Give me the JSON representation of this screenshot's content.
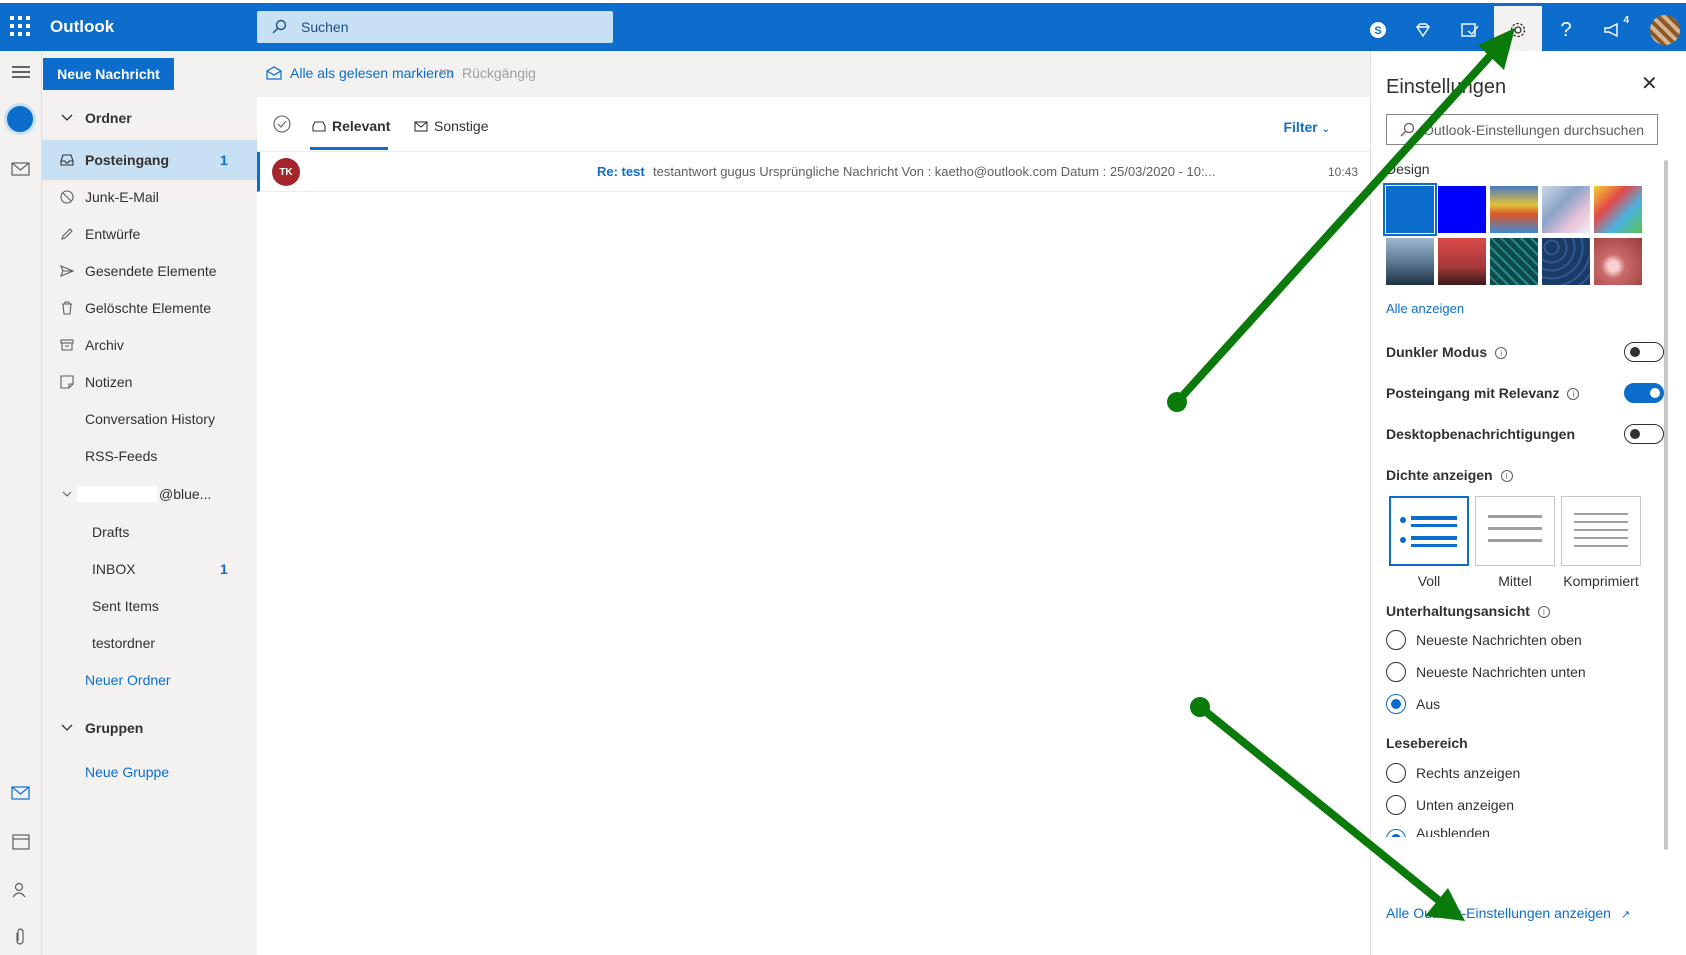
{
  "header": {
    "app_title": "Outlook",
    "search_placeholder": "Suchen",
    "notification_count": "4"
  },
  "commandbar": {
    "new_message": "Neue Nachricht",
    "mark_all_read": "Alle als gelesen markieren",
    "undo": "Rückgängig"
  },
  "folders": {
    "section_title": "Ordner",
    "inbox": "Posteingang",
    "inbox_count": "1",
    "junk": "Junk-E-Mail",
    "drafts": "Entwürfe",
    "sent": "Gesendete Elemente",
    "deleted": "Gelöschte Elemente",
    "archive": "Archiv",
    "notes": "Notizen",
    "conversation_history": "Conversation History",
    "rss": "RSS-Feeds",
    "account": "@blue...",
    "sub_drafts": "Drafts",
    "sub_inbox": "INBOX",
    "sub_inbox_count": "1",
    "sub_sent": "Sent Items",
    "sub_test": "testordner",
    "new_folder": "Neuer Ordner",
    "groups_title": "Gruppen",
    "new_group": "Neue Gruppe"
  },
  "messagelist": {
    "tab_relevant": "Relevant",
    "tab_other": "Sonstige",
    "filter": "Filter",
    "message": {
      "avatar_initials": "TK",
      "subject": "Re: test",
      "preview": "testantwort gugus Ursprüngliche Nachricht Von : kaetho@outlook.com Datum : 25/03/2020 - 10:...",
      "time": "10:43"
    }
  },
  "settings": {
    "title": "Einstellungen",
    "search_placeholder": "Outlook-Einstellungen durchsuchen",
    "design_label": "Design",
    "show_all": "Alle anzeigen",
    "dark_mode": "Dunkler Modus",
    "dark_mode_on": false,
    "focused_inbox": "Posteingang mit Relevanz",
    "focused_inbox_on": true,
    "desktop_notifications": "Desktopbenachrichtigungen",
    "desktop_notifications_on": false,
    "density_label": "Dichte anzeigen",
    "density_full": "Voll",
    "density_medium": "Mittel",
    "density_compact": "Komprimiert",
    "conversation_label": "Unterhaltungsansicht",
    "conv_newest_top": "Neueste Nachrichten oben",
    "conv_newest_bottom": "Neueste Nachrichten unten",
    "conv_off": "Aus",
    "reading_pane_label": "Lesebereich",
    "rp_right": "Rechts anzeigen",
    "rp_bottom": "Unten anzeigen",
    "rp_hide": "Ausblenden",
    "all_settings_link": "Alle Outlook-Einstellungen anzeigen",
    "theme_colors": [
      "#0c6dcc",
      "#0000ff"
    ]
  },
  "colors": {
    "accent": "#0c6dcc",
    "annotation_arrow": "#0a7a0a"
  }
}
